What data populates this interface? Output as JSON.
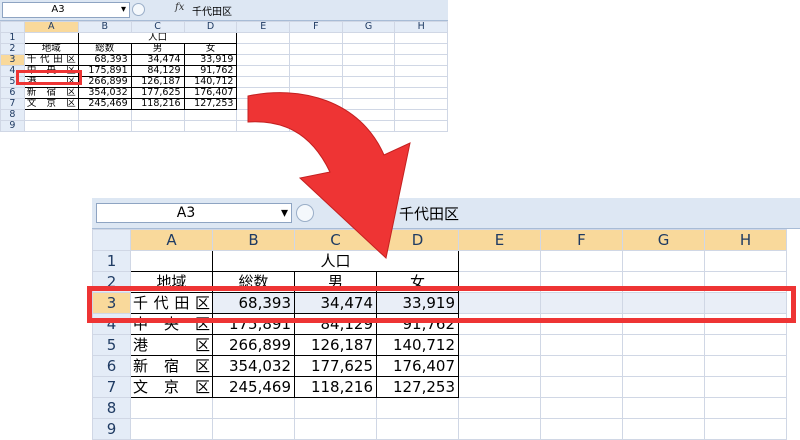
{
  "formula_bar": {
    "name_box": "A3",
    "dropdown_glyph": "▾",
    "fx_label": "fx",
    "value": "千代田区"
  },
  "columns": [
    "A",
    "B",
    "C",
    "D",
    "E",
    "F",
    "G",
    "H"
  ],
  "rows": [
    "1",
    "2",
    "3",
    "4",
    "5",
    "6",
    "7",
    "8",
    "9"
  ],
  "cells": {
    "C1": "人口",
    "A2": "地域",
    "B2": "総数",
    "C2": "男",
    "D2": "女",
    "A3": "千代田区",
    "B3": "68,393",
    "C3": "34,474",
    "D3": "33,919",
    "A4": "中央区",
    "B4": "175,891",
    "C4": "84,129",
    "D4": "91,762",
    "A5": "港区",
    "B5": "266,899",
    "C5": "126,187",
    "D5": "140,712",
    "A6": "新宿区",
    "B6": "354,032",
    "C6": "177,625",
    "D6": "176,407",
    "A7": "文京区",
    "B7": "245,469",
    "C7": "118,216",
    "D7": "127,253"
  },
  "colors": {
    "highlight": "#ee3434",
    "header_bg": "#e4ecf7",
    "selected_header_bg": "#f9d99b"
  }
}
